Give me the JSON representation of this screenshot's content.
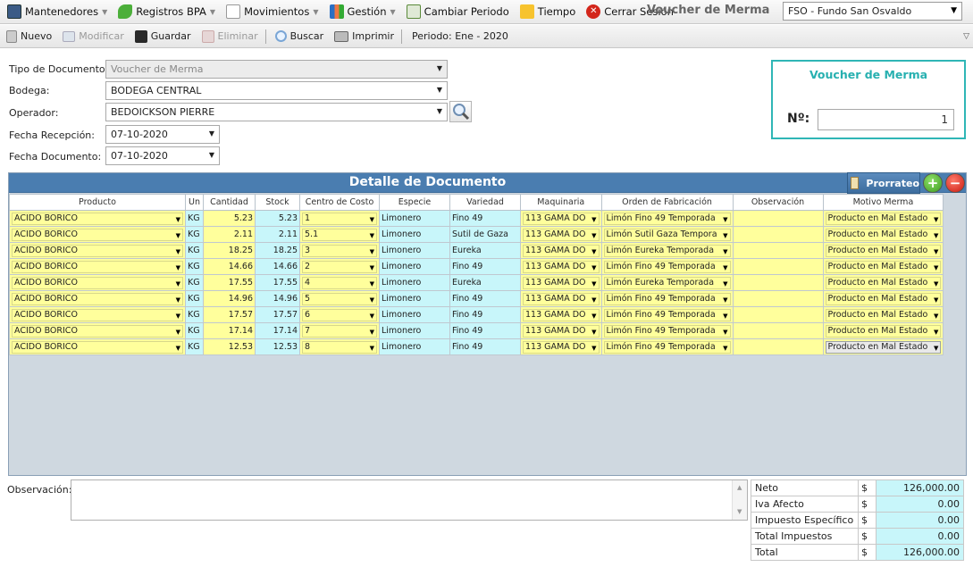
{
  "menu": {
    "items": [
      {
        "label": "Mantenedores",
        "icon": "table-icon",
        "dropdown": true
      },
      {
        "label": "Registros BPA",
        "icon": "leaf-icon",
        "dropdown": true
      },
      {
        "label": "Movimientos",
        "icon": "document-icon",
        "dropdown": true
      },
      {
        "label": "Gestión",
        "icon": "chart-icon",
        "dropdown": true
      },
      {
        "label": "Cambiar Periodo",
        "icon": "calendar-refresh-icon",
        "dropdown": false
      },
      {
        "label": "Tiempo",
        "icon": "weather-icon",
        "dropdown": false
      },
      {
        "label": "Cerrar Sesión",
        "icon": "logout-icon",
        "dropdown": false
      }
    ],
    "title": "Voucher de Merma",
    "fundo": "FSO - Fundo San Osvaldo"
  },
  "toolbar": {
    "nuevo": "Nuevo",
    "modificar": "Modificar",
    "guardar": "Guardar",
    "eliminar": "Eliminar",
    "buscar": "Buscar",
    "imprimir": "Imprimir",
    "periodo": "Periodo: Ene - 2020"
  },
  "form": {
    "tipo_label": "Tipo de Documento:",
    "tipo_value": "Voucher de Merma",
    "bodega_label": "Bodega:",
    "bodega_value": "BODEGA CENTRAL",
    "operador_label": "Operador:",
    "operador_value": "BEDOICKSON PIERRE",
    "fecha_recepcion_label": "Fecha Recepción:",
    "fecha_recepcion_value": "07-10-2020",
    "fecha_documento_label": "Fecha Documento:",
    "fecha_documento_value": "07-10-2020"
  },
  "voucher": {
    "title": "Voucher de Merma",
    "number_label": "Nº:",
    "number_value": "1"
  },
  "grid": {
    "title": "Detalle de Documento",
    "prorrateo": "Prorrateo",
    "add_symbol": "+",
    "remove_symbol": "−",
    "columns": [
      "Producto",
      "Un",
      "Cantidad",
      "Stock",
      "Centro de Costo",
      "Especie",
      "Variedad",
      "Maquinaria",
      "Orden de Fabricación",
      "Observación",
      "Motivo Merma"
    ],
    "rows": [
      {
        "producto": "ACIDO BORICO",
        "un": "KG",
        "cantidad": "5.23",
        "stock": "5.23",
        "centro": "1",
        "especie": "Limonero",
        "variedad": "Fino 49",
        "maquinaria": "113 GAMA DO",
        "orden": "Limón Fino 49 Temporada",
        "obs": "",
        "motivo": "Producto en Mal Estado"
      },
      {
        "producto": "ACIDO BORICO",
        "un": "KG",
        "cantidad": "2.11",
        "stock": "2.11",
        "centro": "5.1",
        "especie": "Limonero",
        "variedad": "Sutil de Gaza",
        "maquinaria": "113 GAMA DO",
        "orden": "Limón Sutil Gaza Tempora",
        "obs": "",
        "motivo": "Producto en Mal Estado"
      },
      {
        "producto": "ACIDO BORICO",
        "un": "KG",
        "cantidad": "18.25",
        "stock": "18.25",
        "centro": "3",
        "especie": "Limonero",
        "variedad": "Eureka",
        "maquinaria": "113 GAMA DO",
        "orden": "Limón Eureka Temporada",
        "obs": "",
        "motivo": "Producto en Mal Estado"
      },
      {
        "producto": "ACIDO BORICO",
        "un": "KG",
        "cantidad": "14.66",
        "stock": "14.66",
        "centro": "2",
        "especie": "Limonero",
        "variedad": "Fino 49",
        "maquinaria": "113 GAMA DO",
        "orden": "Limón Fino 49 Temporada",
        "obs": "",
        "motivo": "Producto en Mal Estado"
      },
      {
        "producto": "ACIDO BORICO",
        "un": "KG",
        "cantidad": "17.55",
        "stock": "17.55",
        "centro": "4",
        "especie": "Limonero",
        "variedad": "Eureka",
        "maquinaria": "113 GAMA DO",
        "orden": "Limón Eureka Temporada",
        "obs": "",
        "motivo": "Producto en Mal Estado"
      },
      {
        "producto": "ACIDO BORICO",
        "un": "KG",
        "cantidad": "14.96",
        "stock": "14.96",
        "centro": "5",
        "especie": "Limonero",
        "variedad": "Fino 49",
        "maquinaria": "113 GAMA DO",
        "orden": "Limón Fino 49 Temporada",
        "obs": "",
        "motivo": "Producto en Mal Estado"
      },
      {
        "producto": "ACIDO BORICO",
        "un": "KG",
        "cantidad": "17.57",
        "stock": "17.57",
        "centro": "6",
        "especie": "Limonero",
        "variedad": "Fino 49",
        "maquinaria": "113 GAMA DO",
        "orden": "Limón Fino 49 Temporada",
        "obs": "",
        "motivo": "Producto en Mal Estado"
      },
      {
        "producto": "ACIDO BORICO",
        "un": "KG",
        "cantidad": "17.14",
        "stock": "17.14",
        "centro": "7",
        "especie": "Limonero",
        "variedad": "Fino 49",
        "maquinaria": "113 GAMA DO",
        "orden": "Limón Fino 49 Temporada",
        "obs": "",
        "motivo": "Producto en Mal Estado"
      },
      {
        "producto": "ACIDO BORICO",
        "un": "KG",
        "cantidad": "12.53",
        "stock": "12.53",
        "centro": "8",
        "especie": "Limonero",
        "variedad": "Fino 49",
        "maquinaria": "113 GAMA DO",
        "orden": "Limón Fino 49 Temporada",
        "obs": "",
        "motivo": "Producto en Mal Estado"
      }
    ]
  },
  "observacion": {
    "label": "Observación:",
    "value": ""
  },
  "totals": [
    {
      "label": "Neto",
      "currency": "$",
      "value": "126,000.00"
    },
    {
      "label": "Iva Afecto",
      "currency": "$",
      "value": "0.00"
    },
    {
      "label": "Impuesto Específico",
      "currency": "$",
      "value": "0.00"
    },
    {
      "label": "Total Impuestos",
      "currency": "$",
      "value": "0.00"
    },
    {
      "label": "Total",
      "currency": "$",
      "value": "126,000.00"
    }
  ],
  "colors": {
    "accent_teal": "#2fb6b6",
    "grid_header": "#4a7db0",
    "cell_yellow": "#ffff9c",
    "cell_cyan": "#c8f6fa"
  }
}
